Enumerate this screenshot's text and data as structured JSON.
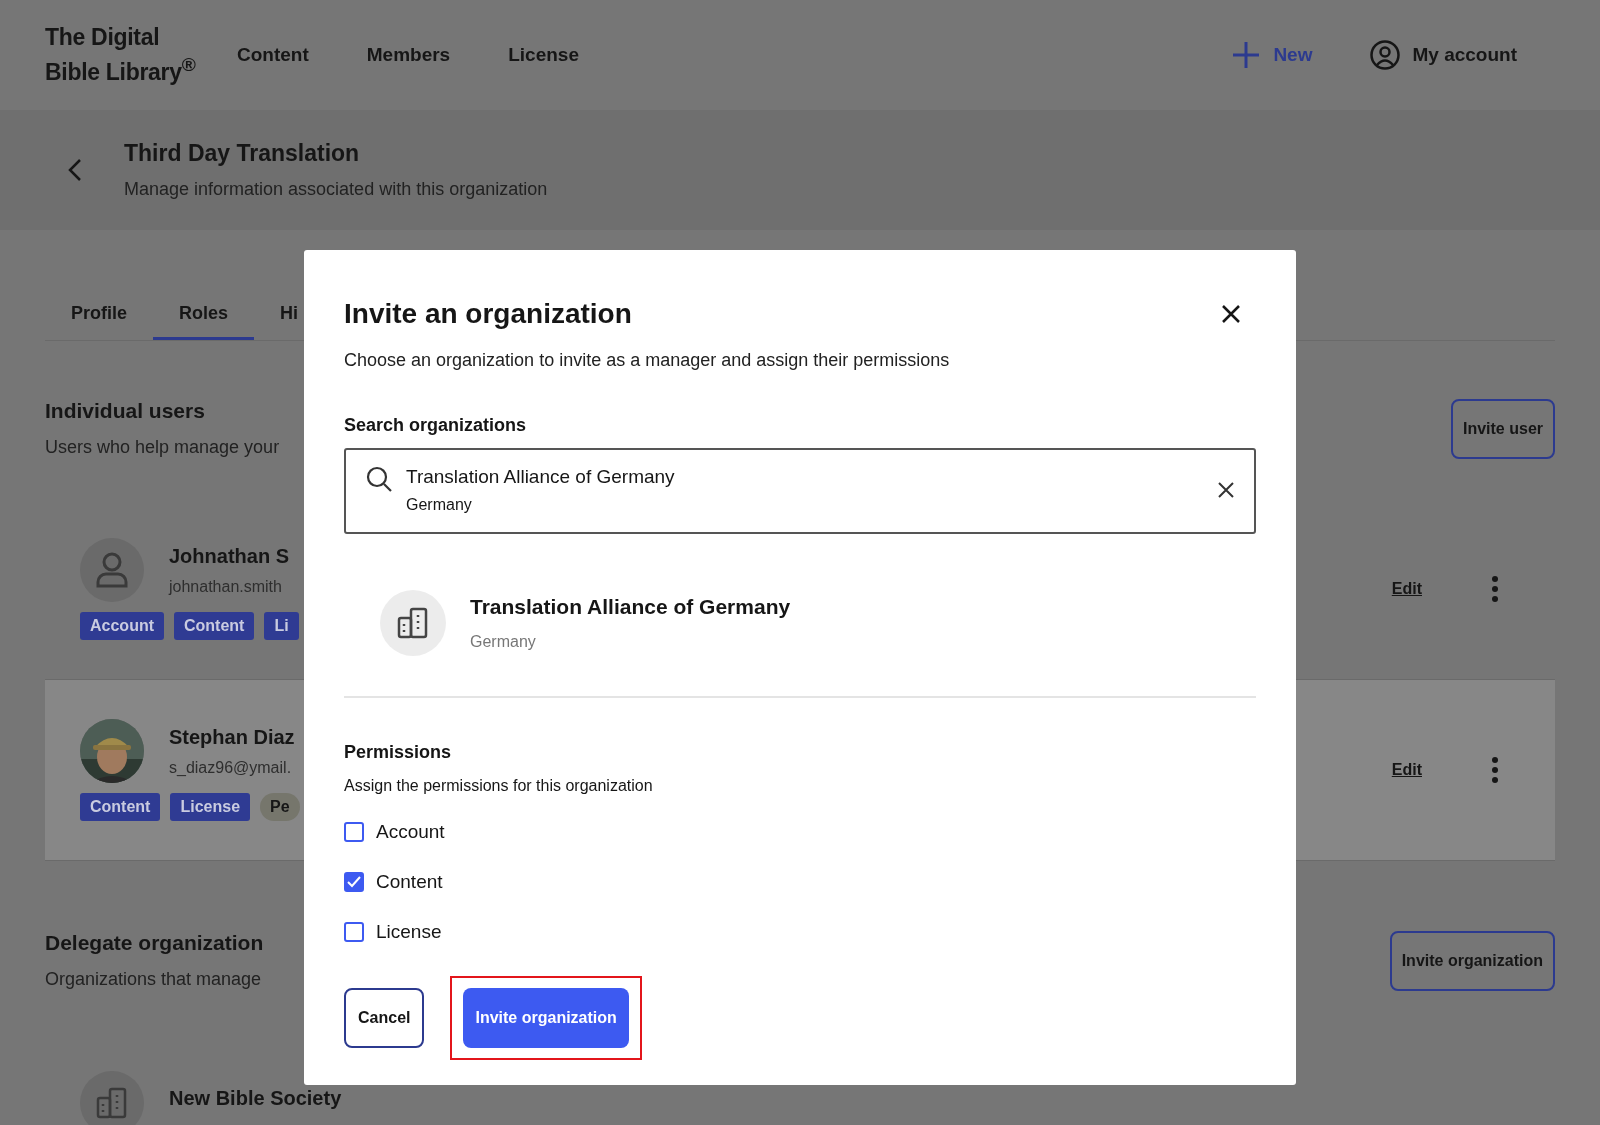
{
  "header": {
    "logo_lines": [
      "The Digital",
      "Bible Library$^{®}$"
    ],
    "nav": [
      "Content",
      "Members",
      "License"
    ],
    "new_button": "New",
    "account": "My account"
  },
  "page_header": {
    "title": "Third Day Translation",
    "subtitle": "Manage information associated with this organization"
  },
  "tabs": [
    {
      "label": "Profile",
      "selected": false
    },
    {
      "label": "Roles",
      "selected": true
    },
    {
      "label": "Hi",
      "selected": false
    }
  ],
  "individual_users": {
    "title": "Individual users",
    "subtitle": "Users who help manage your",
    "invite_button": "Invite user",
    "users": [
      {
        "name": "Johnathan S",
        "email": "johnathan.smith",
        "kind": "placeholder",
        "highlighted": false,
        "edit": "Edit",
        "tags": [
          {
            "label": "Account",
            "kind": "role"
          },
          {
            "label": "Content",
            "kind": "role"
          },
          {
            "label": "Li",
            "kind": "role"
          }
        ]
      },
      {
        "name": "Stephan Diaz",
        "email": "s_diaz96@ymail.",
        "highlighted": true,
        "edit": "Edit",
        "tags": [
          {
            "label": "Content",
            "kind": "role"
          },
          {
            "label": "License",
            "kind": "role"
          },
          {
            "label": "Pe",
            "kind": "pending"
          }
        ]
      }
    ]
  },
  "delegate_organizations": {
    "title": "Delegate organization",
    "subtitle": "Organizations that manage",
    "invite_button": "Invite organization",
    "orgs": [
      {
        "name": "New Bible Society"
      }
    ]
  },
  "modal": {
    "title": "Invite an organization",
    "description": "Choose an organization to invite as a manager and assign their permissions",
    "search_label": "Search organizations",
    "search": {
      "value": "Translation Alliance of Germany",
      "sublabel": "Germany"
    },
    "result": {
      "name": "Translation Alliance of Germany",
      "country": "Germany"
    },
    "permissions_title": "Permissions",
    "permissions_hint": "Assign the permissions for this organization",
    "permissions": [
      {
        "label": "Account",
        "checked": false
      },
      {
        "label": "Content",
        "checked": true
      },
      {
        "label": "License",
        "checked": false
      }
    ],
    "cancel": "Cancel",
    "submit": "Invite organization",
    "submit_highlighted": true
  }
}
